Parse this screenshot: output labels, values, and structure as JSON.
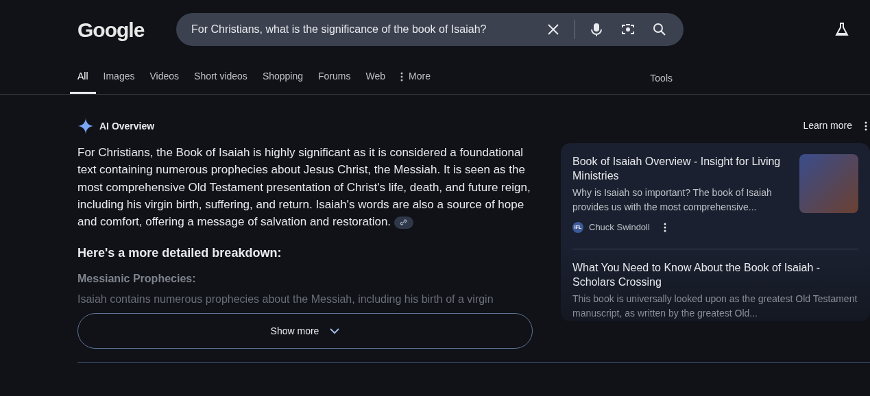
{
  "logo": {
    "text": "Google"
  },
  "search": {
    "value": "For Christians, what is the significance of the book of Isaiah?"
  },
  "tabs": [
    {
      "label": "All",
      "selected": true
    },
    {
      "label": "Images",
      "selected": false
    },
    {
      "label": "Videos",
      "selected": false
    },
    {
      "label": "Short videos",
      "selected": false
    },
    {
      "label": "Shopping",
      "selected": false
    },
    {
      "label": "Forums",
      "selected": false
    },
    {
      "label": "Web",
      "selected": false
    },
    {
      "label": "More",
      "selected": false,
      "kind": "menu"
    }
  ],
  "tools": "Tools",
  "overview": {
    "title": "AI Overview",
    "learn_more": "Learn more",
    "summary": "For Christians, the Book of Isaiah is highly significant as it is considered a foundational text containing numerous prophecies about Jesus Christ, the Messiah. It is seen as the most comprehensive Old Testament presentation of Christ's life, death, and future reign, including his virgin birth, suffering, and return. Isaiah's words are also a source of hope and comfort, offering a message of salvation and restoration.",
    "breakdown_heading": "Here's a more detailed breakdown:",
    "point_heading": "Messianic Prophecies:",
    "point_text": "Isaiah contains numerous prophecies about the Messiah, including his birth of a virgin",
    "show_more": "Show more"
  },
  "sources": [
    {
      "title": "Book of Isaiah Overview - Insight for Living Ministries",
      "snippet": "Why is Isaiah so important? The book of Isaiah provides us with the most comprehensive...",
      "badge": "IFL",
      "site": "Chuck Swindoll",
      "photo": true
    },
    {
      "title": "What You Need to Know About the Book of Isaiah - Scholars Crossing",
      "snippet": "This book is universally looked upon as the greatest Old Testament manuscript, as written by the greatest Old...",
      "photo": false
    }
  ]
}
